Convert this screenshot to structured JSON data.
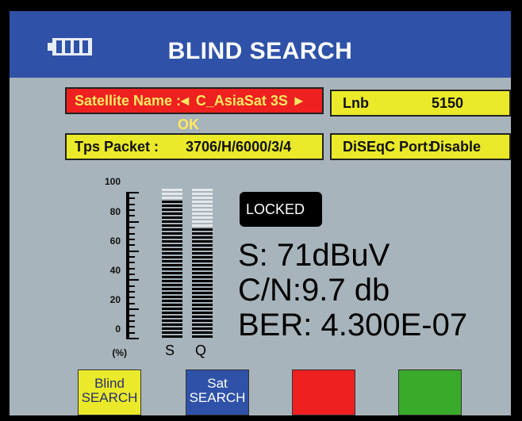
{
  "header": {
    "title": "BLIND SEARCH",
    "battery_icon": "battery-icon"
  },
  "fields": {
    "satellite_name": {
      "label": "Satellite Name :",
      "value": "◄  C_AsiaSat 3S  ►  OK"
    },
    "lnb": {
      "label": "Lnb",
      "value": "5150"
    },
    "tps_packet": {
      "label": "Tps Packet :",
      "value": "3706/H/6000/3/4"
    },
    "diseqc_port": {
      "label": "DiSEqC Port:",
      "value": "Disable"
    }
  },
  "meter": {
    "scale": [
      "100",
      "80",
      "60",
      "40",
      "20",
      "0"
    ],
    "unit": "(%)",
    "s_label": "S",
    "q_label": "Q",
    "signal_level": 0.93,
    "quality_level": 0.73
  },
  "status": {
    "locked": "LOCKED",
    "signal": "S: 71dBuV",
    "cn": "C/N:9.7 db",
    "ber": "BER: 4.300E-07"
  },
  "function_keys": {
    "yellow": {
      "line1": "Blind",
      "line2": "SEARCH"
    },
    "blue": {
      "line1": "Sat",
      "line2": "SEARCH"
    }
  },
  "colors": {
    "header": "#2f52a8",
    "background": "#a8b4bb",
    "yellow": "#eaea2a",
    "red": "#ee2020",
    "green": "#3aaa2a",
    "blue": "#2f52a8"
  }
}
